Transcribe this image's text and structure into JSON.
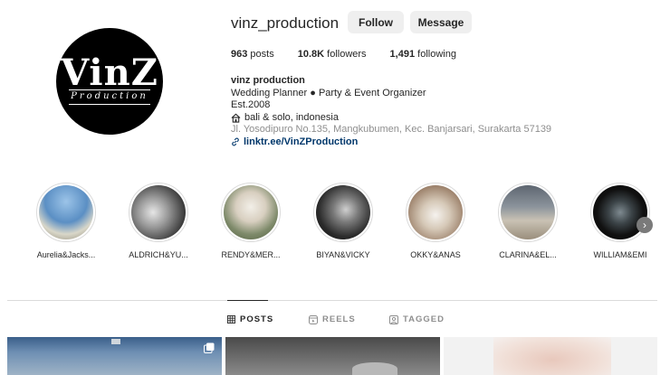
{
  "profile": {
    "username": "vinz_production",
    "follow_label": "Follow",
    "message_label": "Message",
    "logo": {
      "main": "VinZ",
      "sub": "Production"
    }
  },
  "stats": {
    "posts": {
      "count": "963",
      "label": "posts"
    },
    "followers": {
      "count": "10.8K",
      "label": "followers"
    },
    "following": {
      "count": "1,491",
      "label": "following"
    }
  },
  "bio": {
    "name": "vinz production",
    "line1": "Wedding Planner ● Party & Event Organizer",
    "line2": "Est.2008",
    "location": "bali & solo, indonesia",
    "address": "Jl. Yosodipuro No.135, Mangkubumen, Kec. Banjarsari, Surakarta 57139",
    "link": "linktr.ee/VinZProduction"
  },
  "highlights": [
    {
      "label": "Aurelia&Jacks..."
    },
    {
      "label": "ALDRICH&YU..."
    },
    {
      "label": "RENDY&MER..."
    },
    {
      "label": "BIYAN&VICKY"
    },
    {
      "label": "OKKY&ANAS"
    },
    {
      "label": "CLARINA&EL..."
    },
    {
      "label": "WILLIAM&EMI"
    }
  ],
  "tabs": [
    {
      "label": "POSTS",
      "icon": "grid-icon",
      "active": true
    },
    {
      "label": "REELS",
      "icon": "reels-icon",
      "active": false
    },
    {
      "label": "TAGGED",
      "icon": "tagged-icon",
      "active": false
    }
  ]
}
